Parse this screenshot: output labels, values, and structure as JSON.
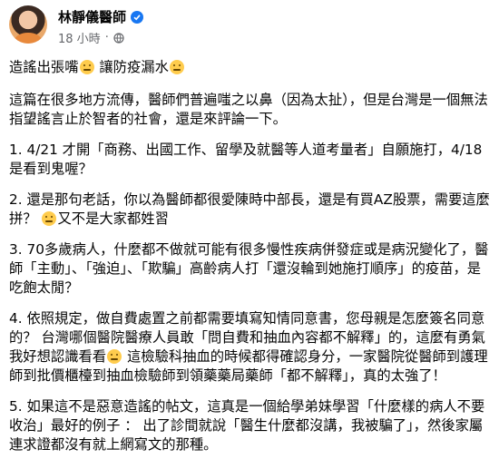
{
  "post": {
    "author": "林靜儀醫師",
    "time": "18 小時",
    "dot": "·",
    "paragraphs": [
      [
        "造謠出張嘴",
        "讓防疫漏水",
        ""
      ],
      [
        "這篇在很多地方流傳，醫師們普遍嗤之以鼻（因為太扯），但是台灣是一個無法指望謠言止於智者的社會，還是來評論一下。"
      ],
      [
        "1. 4/21 才開「商務、出國工作、留學及就醫等人道考量者」自願施打，4/18 是看到鬼喔？"
      ],
      [
        "2. 還是那句老話，你以為醫師都很愛陳時中部長，還是有買AZ股票，需要這麼拼？",
        "又不是大家都姓習"
      ],
      [
        "3. 70多歲病人，什麼都不做就可能有很多慢性疾病併發症或是病況變化了，醫師「主動」、「強迫」、「欺騙」高齡病人打「還沒輪到她施打順序」的疫苗，是吃飽太閒？"
      ],
      [
        "4. 依照規定，做自費處置之前都需要填寫知情同意書，您母親是怎麼簽名同意的？ 台灣哪個醫院醫療人員敢「問自費和抽血內容都不解釋」的，這麼有勇氣我好想認識看看",
        "這檢驗科抽血的時候都得確認身分，一家醫院從醫師到護理師到批價櫃檯到抽血檢驗師到領藥藥局藥師「都不解釋」，真的太強了！"
      ],
      [
        "5. 如果這不是惡意造謠的帖文，這真是一個給學弟妹學習「什麼樣的病人不要收治」最好的例子 ： 出了診間就說「醫生什麼都沒講，我被騙了」，然後家屬連求證都沒有就上網寫文的那種。"
      ]
    ]
  },
  "colors": {
    "verified": "#1877f2",
    "meta": "#65676b",
    "text": "#050505"
  },
  "icons": {
    "verified": "check-badge-icon",
    "audience": "globe-icon",
    "emoji": "smiley-emoji-icon"
  }
}
